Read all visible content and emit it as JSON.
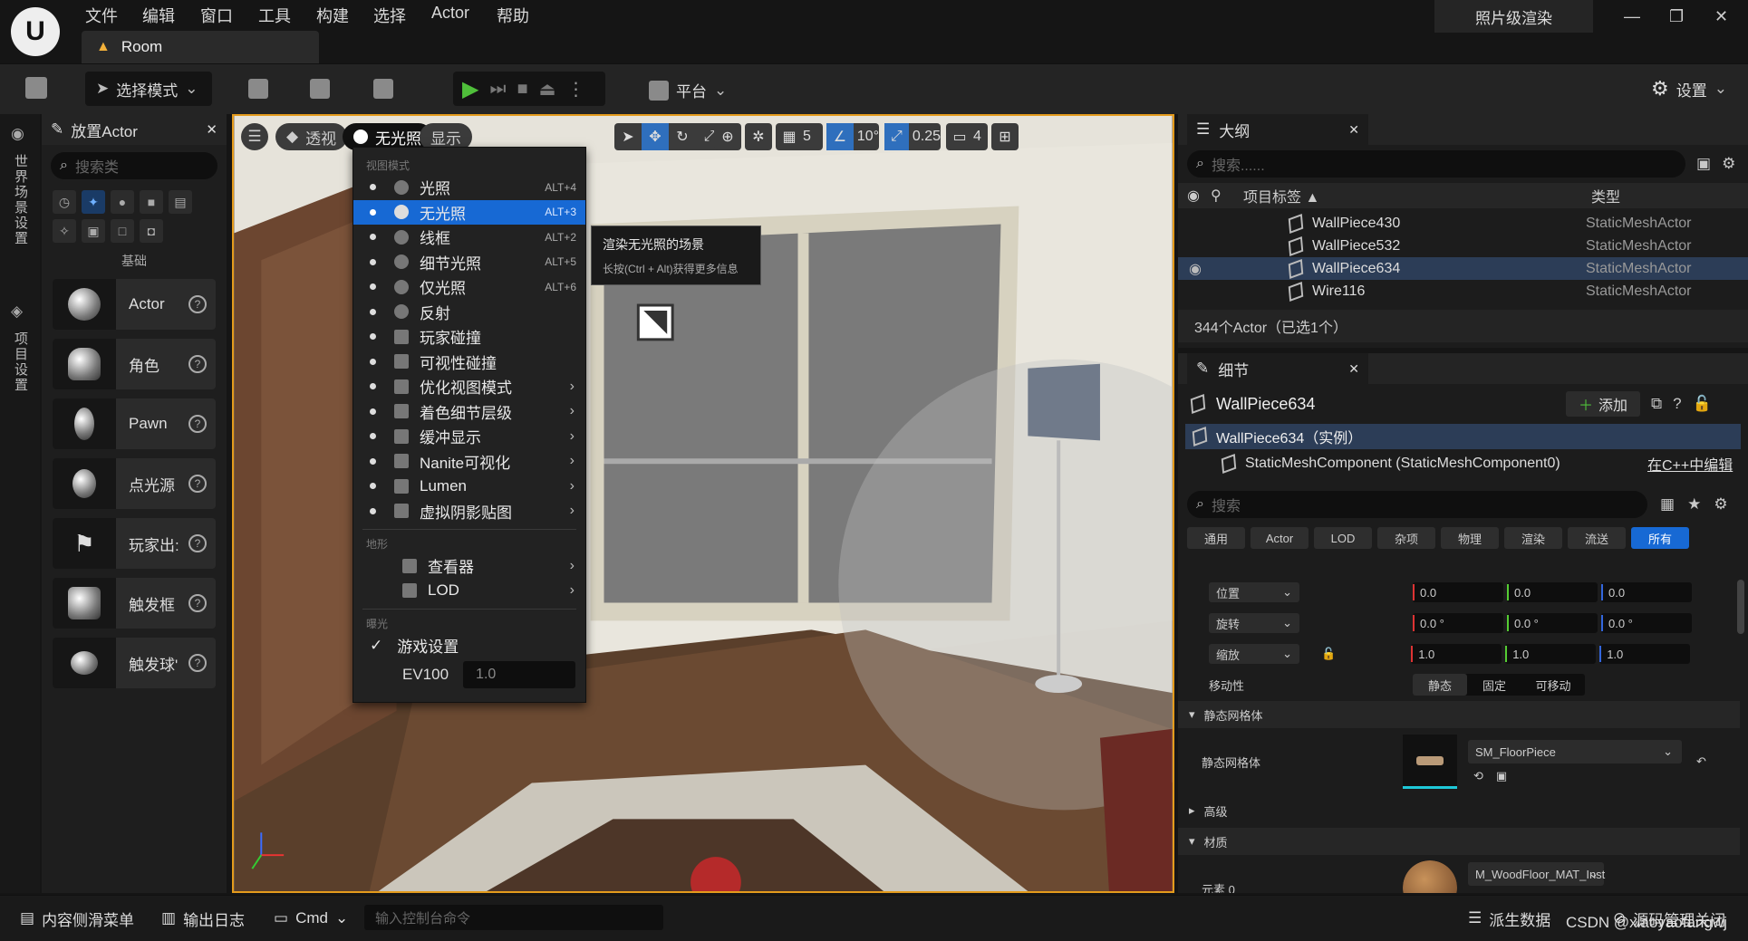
{
  "app": {
    "logo": "U",
    "menu": [
      "文件",
      "编辑",
      "窗口",
      "工具",
      "构建",
      "选择",
      "Actor",
      "帮助"
    ],
    "tab_title": "Room",
    "photo_mode": "照片级渲染",
    "window_controls": [
      "—",
      "❐",
      "✕"
    ]
  },
  "toolbar": {
    "select_mode": "选择模式",
    "platform": "平台",
    "settings": "设置"
  },
  "left_strip": {
    "world_settings": "世界场景设置",
    "project_settings": "项目设置"
  },
  "place_actor": {
    "title": "放置Actor",
    "search_placeholder": "搜索类",
    "category_label": "基础",
    "items": [
      {
        "label": "Actor"
      },
      {
        "label": "角色"
      },
      {
        "label": "Pawn"
      },
      {
        "label": "点光源"
      },
      {
        "label": "玩家出:"
      },
      {
        "label": "触发框"
      },
      {
        "label": "触发球'"
      }
    ]
  },
  "viewport": {
    "perspective": "透视",
    "lit_mode": "无光照",
    "show": "显示",
    "grid_value": "5",
    "rotation_snap": "10°",
    "scale_snap": "0.25",
    "camera_speed": "4"
  },
  "view_mode_menu": {
    "section_view": "视图模式",
    "items": [
      {
        "label": "光照",
        "shortcut": "ALT+4",
        "arrow": false
      },
      {
        "label": "无光照",
        "shortcut": "ALT+3",
        "arrow": false,
        "selected": true
      },
      {
        "label": "线框",
        "shortcut": "ALT+2",
        "arrow": false
      },
      {
        "label": "细节光照",
        "shortcut": "ALT+5",
        "arrow": false
      },
      {
        "label": "仅光照",
        "shortcut": "ALT+6",
        "arrow": false
      },
      {
        "label": "反射",
        "shortcut": "",
        "arrow": false
      },
      {
        "label": "玩家碰撞",
        "shortcut": "",
        "arrow": false
      },
      {
        "label": "可视性碰撞",
        "shortcut": "",
        "arrow": false
      },
      {
        "label": "优化视图模式",
        "shortcut": "",
        "arrow": true
      },
      {
        "label": "着色细节层级",
        "shortcut": "",
        "arrow": true
      },
      {
        "label": "缓冲显示",
        "shortcut": "",
        "arrow": true
      },
      {
        "label": "Nanite可视化",
        "shortcut": "",
        "arrow": true
      },
      {
        "label": "Lumen",
        "shortcut": "",
        "arrow": true
      },
      {
        "label": "虚拟阴影贴图",
        "shortcut": "",
        "arrow": true
      }
    ],
    "section_terrain": "地形",
    "terrain_items": [
      {
        "label": "查看器",
        "arrow": true
      },
      {
        "label": "LOD",
        "arrow": true
      }
    ],
    "section_exposure": "曝光",
    "game_settings": "游戏设置",
    "ev100_label": "EV100",
    "ev100_value": "1.0"
  },
  "tooltip": {
    "title": "渲染无光照的场景",
    "hint": "长按(Ctrl + Alt)获得更多信息"
  },
  "outliner": {
    "title": "大纲",
    "search_placeholder": "搜索......",
    "col_label": "项目标签 ▲",
    "col_type": "类型",
    "rows": [
      {
        "name": "WallPiece430",
        "type": "StaticMeshActor"
      },
      {
        "name": "WallPiece532",
        "type": "StaticMeshActor"
      },
      {
        "name": "WallPiece634",
        "type": "StaticMeshActor"
      },
      {
        "name": "Wire116",
        "type": "StaticMeshActor"
      }
    ],
    "count": "344个Actor（已选1个）"
  },
  "details": {
    "title": "细节",
    "object_name": "WallPiece634",
    "add_button": "添加",
    "instance": "WallPiece634（实例）",
    "component": "StaticMeshComponent (StaticMeshComponent0)",
    "edit_cpp": "在C++中编辑",
    "search_placeholder": "搜索",
    "tabs": [
      "通用",
      "Actor",
      "LOD",
      "杂项",
      "物理",
      "渲染",
      "流送",
      "所有"
    ],
    "location_label": "位置",
    "rotation_label": "旋转",
    "scale_label": "缩放",
    "location": [
      "0.0",
      "0.0",
      "0.0"
    ],
    "rotation": [
      "0.0 °",
      "0.0 °",
      "0.0 °"
    ],
    "scale": [
      "1.0",
      "1.0",
      "1.0"
    ],
    "mobility_label": "移动性",
    "mobility_options": [
      "静态",
      "固定",
      "可移动"
    ],
    "section_static_mesh": "静态网格体",
    "static_mesh_label": "静态网格体",
    "static_mesh_value": "SM_FloorPiece",
    "section_advanced": "高级",
    "section_materials": "材质",
    "element0_label": "元素 0",
    "material_value": "M_WoodFloor_MAT_Inst"
  },
  "statusbar": {
    "content_drawer": "内容侧滑菜单",
    "output_log": "输出日志",
    "cmd": "Cmd",
    "console_placeholder": "输入控制台命令",
    "derived_data": "派生数据",
    "source_control": "源码管理关闭",
    "watermark": "CSDN @xiaoyaofangwj"
  }
}
